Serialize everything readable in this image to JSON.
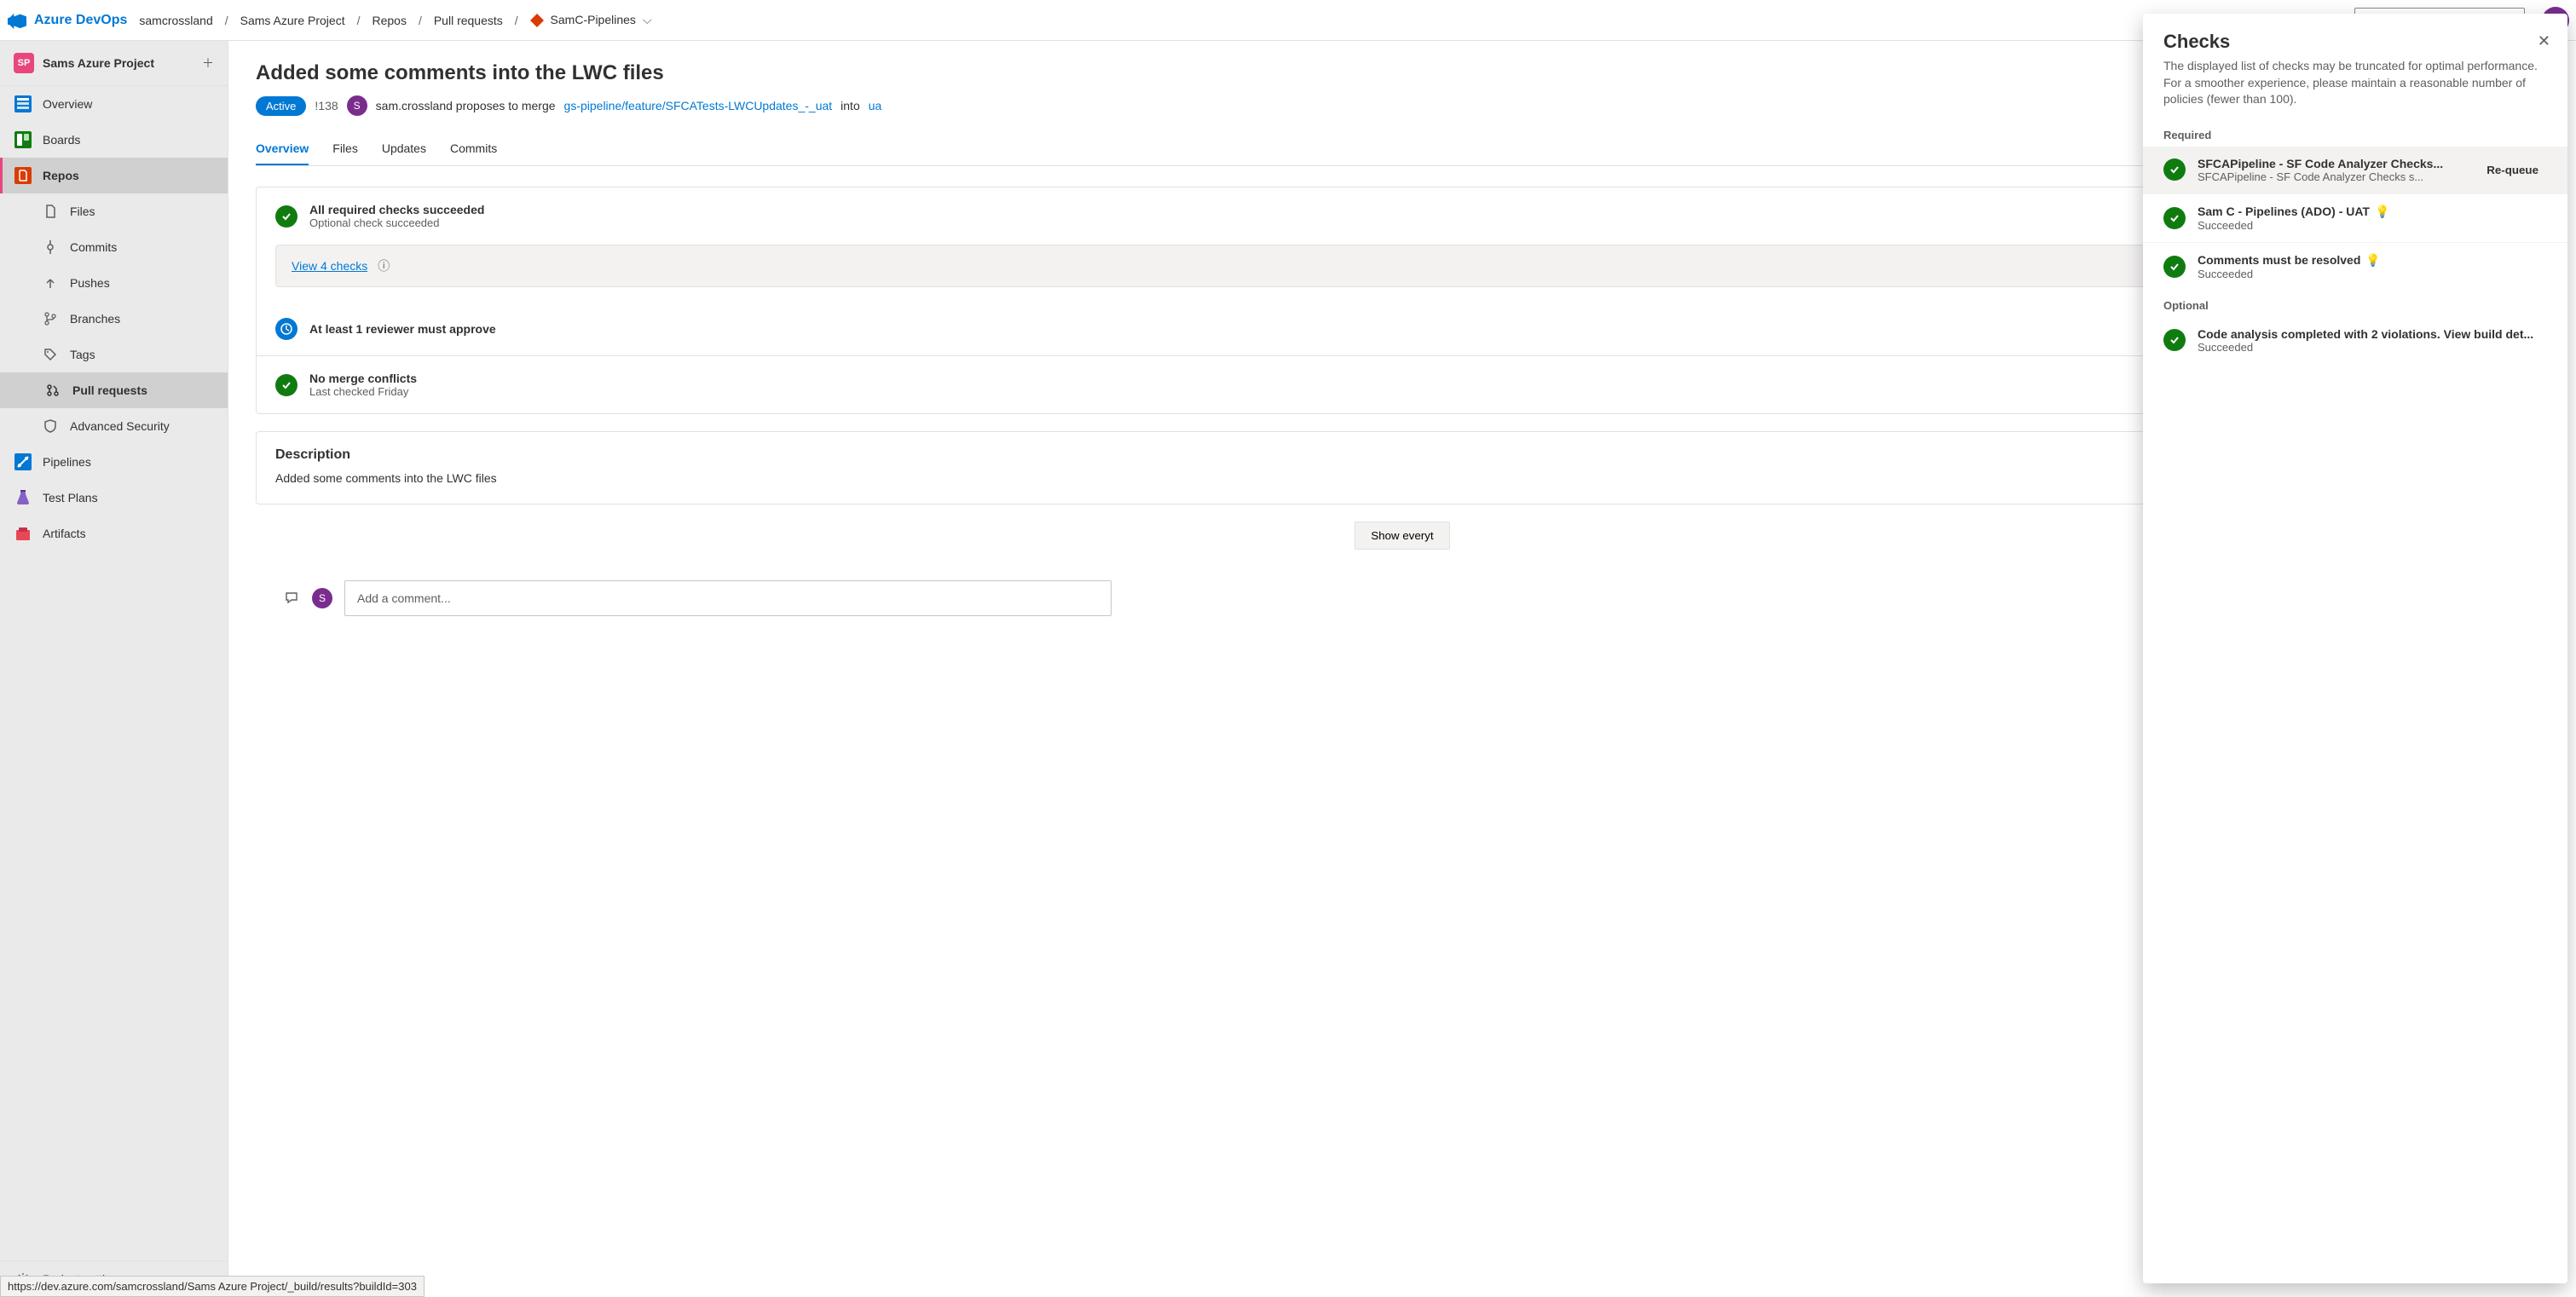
{
  "brand": "Azure DevOps",
  "breadcrumbs": {
    "org": "samcrossland",
    "project": "Sams Azure Project",
    "repos": "Repos",
    "pullrequests": "Pull requests",
    "pipeline": "SamC-Pipelines"
  },
  "project": {
    "badge": "SP",
    "name": "Sams Azure Project"
  },
  "sidebar": {
    "items": [
      {
        "label": "Overview"
      },
      {
        "label": "Boards"
      },
      {
        "label": "Repos"
      },
      {
        "label": "Files"
      },
      {
        "label": "Commits"
      },
      {
        "label": "Pushes"
      },
      {
        "label": "Branches"
      },
      {
        "label": "Tags"
      },
      {
        "label": "Pull requests"
      },
      {
        "label": "Advanced Security"
      },
      {
        "label": "Pipelines"
      },
      {
        "label": "Test Plans"
      },
      {
        "label": "Artifacts"
      }
    ],
    "footer": "Project settings"
  },
  "pr": {
    "title": "Added some comments into the LWC files",
    "status": "Active",
    "id": "!138",
    "user_initial": "S",
    "proposes": "sam.crossland proposes to merge",
    "source_branch": "gs-pipeline/feature/SFCATests-LWCUpdates_-_uat",
    "into": "into",
    "target_branch": "ua"
  },
  "tabs": [
    "Overview",
    "Files",
    "Updates",
    "Commits"
  ],
  "statusCard": {
    "checksTitle": "All required checks succeeded",
    "checksSub": "Optional check succeeded",
    "viewChecks": "View 4 checks",
    "reviewer": "At least 1 reviewer must approve",
    "conflictsTitle": "No merge conflicts",
    "conflictsSub": "Last checked Friday"
  },
  "description": {
    "heading": "Description",
    "body": "Added some comments into the LWC files"
  },
  "showToggle": "Show everyt",
  "commentPlaceholder": "Add a comment...",
  "panel": {
    "title": "Checks",
    "desc": "The displayed list of checks may be truncated for optimal performance. For a smoother experience, please maintain a reasonable number of policies (fewer than 100).",
    "requiredLabel": "Required",
    "optionalLabel": "Optional",
    "requeue": "Re-queue",
    "required": [
      {
        "title": "SFCAPipeline - SF Code Analyzer Checks...",
        "sub": "SFCAPipeline - SF Code Analyzer Checks s...",
        "bulb": false
      },
      {
        "title": "Sam C - Pipelines (ADO) - UAT",
        "sub": "Succeeded",
        "bulb": true
      },
      {
        "title": "Comments must be resolved",
        "sub": "Succeeded",
        "bulb": true
      }
    ],
    "optional": [
      {
        "title": "Code analysis completed with 2 violations. View build det...",
        "sub": "Succeeded"
      }
    ]
  },
  "statusLink": "https://dev.azure.com/samcrossland/Sams Azure Project/_build/results?buildId=303"
}
